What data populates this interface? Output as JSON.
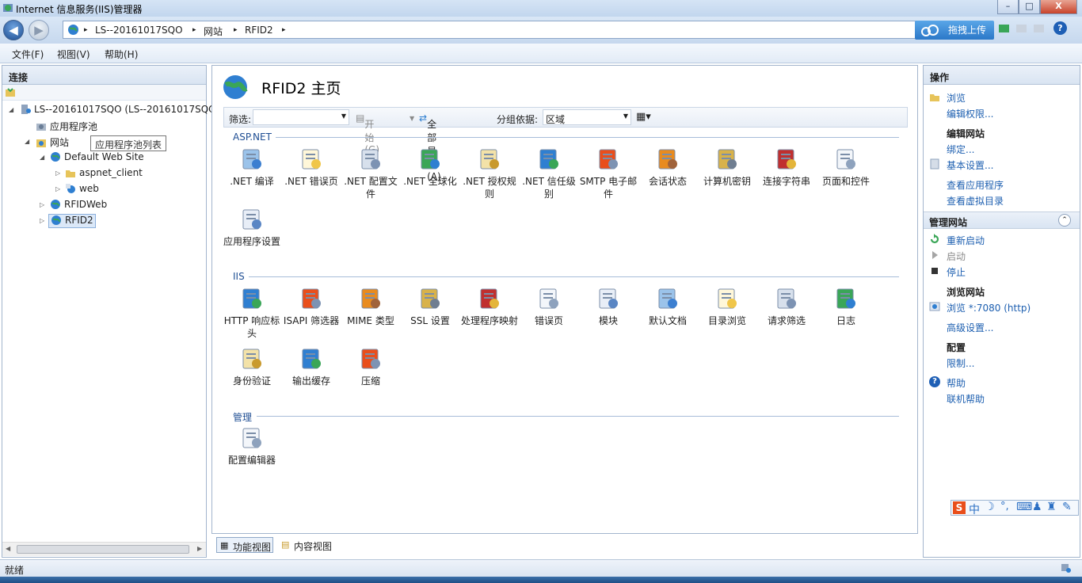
{
  "window": {
    "title": "Internet 信息服务(IIS)管理器",
    "min": "–",
    "max": "□",
    "close": "X"
  },
  "address": {
    "segments": [
      "LS--20161017SQO",
      "网站",
      "RFID2"
    ],
    "sep": "▸",
    "upload": "拖拽上传",
    "help": "?"
  },
  "menu": [
    "文件(F)",
    "视图(V)",
    "帮助(H)"
  ],
  "connections": {
    "title": "连接",
    "tree": [
      {
        "label": "LS--20161017SQO (LS--20161017SQO"
      },
      {
        "label": "应用程序池"
      },
      {
        "label": "网站"
      },
      {
        "label": "Default Web Site"
      },
      {
        "label": "aspnet_client"
      },
      {
        "label": "web"
      },
      {
        "label": "RFIDWeb"
      },
      {
        "label": "RFID2"
      }
    ],
    "tooltip": "应用程序池列表"
  },
  "center": {
    "title": "RFID2 主页",
    "filter": {
      "label": "筛选:",
      "start": "开始(G)",
      "showall": "全部显示(A)",
      "groupby": "分组依据:",
      "group_value": "区域"
    },
    "groups": [
      {
        "name": "ASP.NET",
        "items": [
          ".NET 编译",
          ".NET 错误页",
          ".NET 配置文件",
          ".NET 全球化",
          ".NET 授权规则",
          ".NET 信任级别",
          "SMTP 电子邮件",
          "会话状态",
          "计算机密钥",
          "连接字符串",
          "页面和控件",
          "应用程序设置"
        ]
      },
      {
        "name": "IIS",
        "items": [
          "HTTP 响应标头",
          "ISAPI 筛选器",
          "MIME 类型",
          "SSL 设置",
          "处理程序映射",
          "错误页",
          "模块",
          "默认文档",
          "目录浏览",
          "请求筛选",
          "日志",
          "身份验证",
          "输出缓存",
          "压缩"
        ]
      },
      {
        "name": "管理",
        "items": [
          "配置编辑器"
        ]
      }
    ],
    "tabs": [
      "功能视图",
      "内容视图"
    ]
  },
  "actions": {
    "title": "操作",
    "browse": "浏览",
    "edit_perm": "编辑权限...",
    "edit_site": "编辑网站",
    "bind": "绑定...",
    "basic": "基本设置...",
    "view_apps": "查看应用程序",
    "view_vdirs": "查看虚拟目录",
    "manage_site": "管理网站",
    "restart": "重新启动",
    "start": "启动",
    "stop": "停止",
    "browse_site": "浏览网站",
    "browse_port": "浏览 *:7080 (http)",
    "advanced": "高级设置...",
    "config": "配置",
    "limits": "限制...",
    "help": "帮助",
    "online_help": "联机帮助"
  },
  "status": {
    "text": "就绪"
  },
  "ime": {
    "s": "S",
    "lang": "中"
  }
}
